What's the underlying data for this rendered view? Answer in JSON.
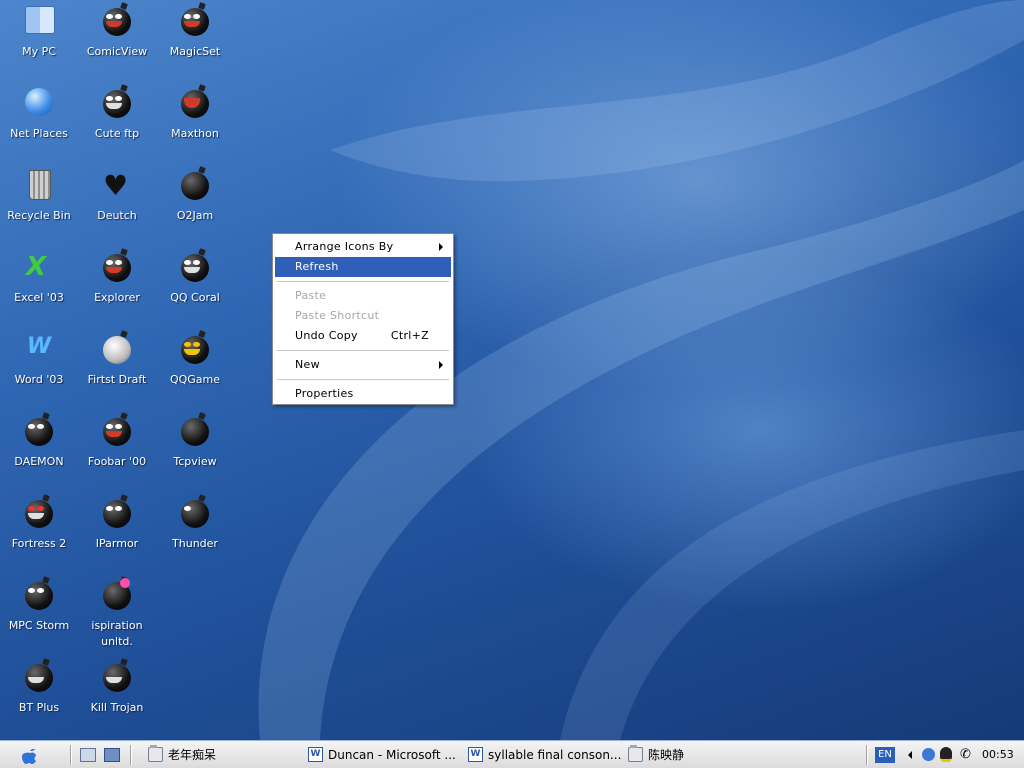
{
  "desktop": {
    "icons": [
      {
        "label": "My PC",
        "icon": "my-pc-icon"
      },
      {
        "label": "ComicView",
        "icon": "comicview-icon"
      },
      {
        "label": "MagicSet",
        "icon": "magicset-icon"
      },
      {
        "label": "Net Places",
        "icon": "net-places-icon"
      },
      {
        "label": "Cute ftp",
        "icon": "cute-ftp-icon"
      },
      {
        "label": "Maxthon",
        "icon": "maxthon-icon"
      },
      {
        "label": "Recycle Bin",
        "icon": "recycle-bin-icon"
      },
      {
        "label": "Deutch",
        "icon": "deutch-icon"
      },
      {
        "label": "O2Jam",
        "icon": "o2jam-icon"
      },
      {
        "label": "Excel '03",
        "icon": "excel-icon"
      },
      {
        "label": "Explorer",
        "icon": "explorer-icon"
      },
      {
        "label": "QQ Coral",
        "icon": "qq-coral-icon"
      },
      {
        "label": "Word '03",
        "icon": "word-icon"
      },
      {
        "label": "Firtst Draft",
        "icon": "first-draft-icon"
      },
      {
        "label": "QQGame",
        "icon": "qqgame-icon"
      },
      {
        "label": "DAEMON",
        "icon": "daemon-icon"
      },
      {
        "label": "Foobar '00",
        "icon": "foobar-icon"
      },
      {
        "label": "Tcpview",
        "icon": "tcpview-icon"
      },
      {
        "label": "Fortress 2",
        "icon": "fortress-icon"
      },
      {
        "label": "IParmor",
        "icon": "iparmor-icon"
      },
      {
        "label": "Thunder",
        "icon": "thunder-icon"
      },
      {
        "label": "MPC Storm",
        "icon": "mpc-storm-icon"
      },
      {
        "label": "ispiration unltd.",
        "icon": "ispiration-icon"
      },
      {
        "label": "BT Plus",
        "icon": "bt-plus-icon"
      },
      {
        "label": "Kill Trojan",
        "icon": "kill-trojan-icon"
      }
    ]
  },
  "context_menu": {
    "arrange": "Arrange Icons By",
    "refresh": "Refresh",
    "paste": "Paste",
    "paste_shortcut": "Paste Shortcut",
    "undo_copy": "Undo Copy",
    "undo_shortcut": "Ctrl+Z",
    "new": "New",
    "properties": "Properties"
  },
  "taskbar": {
    "tasks": [
      {
        "label": "老年痴呆",
        "icon": "folder-icon"
      },
      {
        "label": "Duncan - Microsoft ...",
        "icon": "word-doc-icon"
      },
      {
        "label": "syllable final conson...",
        "icon": "word-doc-icon"
      },
      {
        "label": "陈映静",
        "icon": "folder-icon"
      }
    ],
    "language": "EN",
    "clock": "00:53"
  },
  "colors": {
    "menu_highlight": "#2f5fb8",
    "desktop_blue": "#2f67b4",
    "taskbar_bg": "#e6e6e6"
  }
}
